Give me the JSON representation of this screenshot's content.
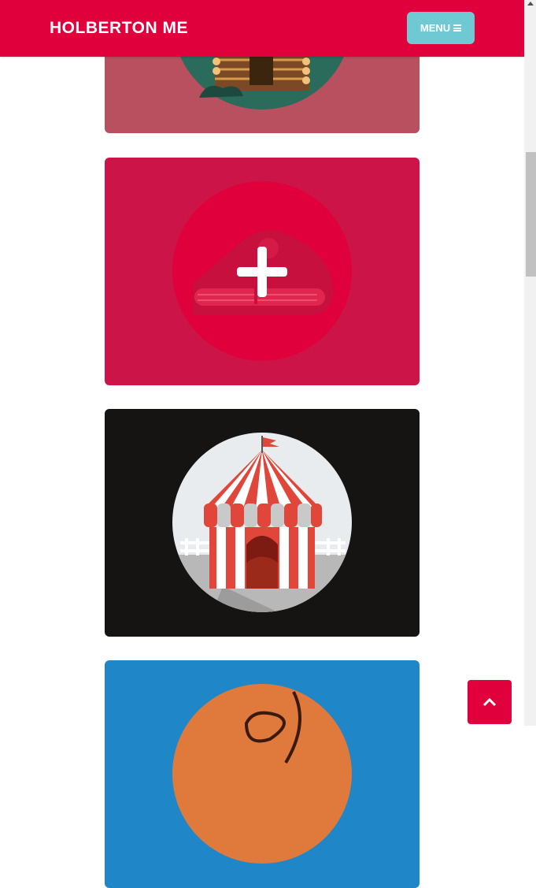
{
  "header": {
    "brand": "HOLBERTON ME",
    "menu_label": "MENU"
  },
  "cards": [
    {
      "name": "log-cabin",
      "background": "#b8505f"
    },
    {
      "name": "submarine",
      "background": "#cc1448",
      "hover_overlay_icon": "plus-icon"
    },
    {
      "name": "circus-tent",
      "background": "#161413"
    },
    {
      "name": "basketball",
      "background": "#1f86c7"
    }
  ],
  "colors": {
    "brand": "#e0003c",
    "menu_button": "#6fc9d2"
  }
}
